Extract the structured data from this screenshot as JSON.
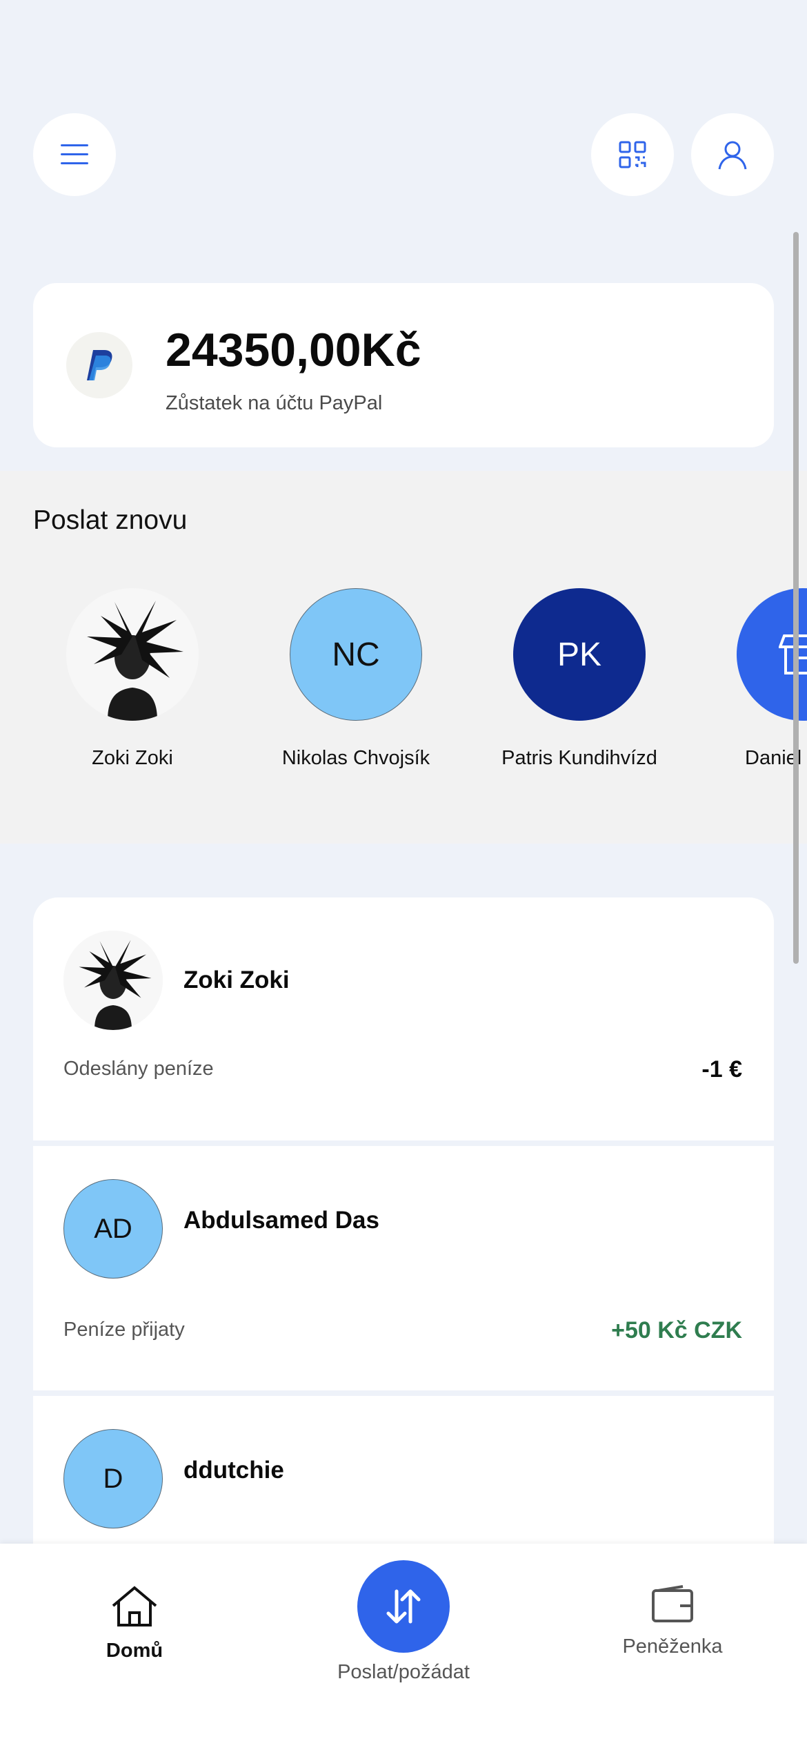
{
  "header": {
    "menu_icon": "hamburger-menu-icon",
    "qr_icon": "qr-code-icon",
    "profile_icon": "user-profile-icon"
  },
  "balance": {
    "amount": "24350,00Kč",
    "label": "Zůstatek na účtu PayPal",
    "logo_icon": "paypal-logo-icon"
  },
  "send_again": {
    "title": "Poslat znovu",
    "contacts": [
      {
        "name": "Zoki Zoki",
        "initials": "",
        "avatar": "photo"
      },
      {
        "name": "Nikolas Chvojsík",
        "initials": "NC",
        "avatar": "light"
      },
      {
        "name": "Patris Kundihvízd",
        "initials": "PK",
        "avatar": "dark"
      },
      {
        "name": "Daniel",
        "initials": "",
        "avatar": "store-icon"
      }
    ]
  },
  "transactions": [
    {
      "name": "Zoki Zoki",
      "initials": "",
      "description": "Odeslány peníze",
      "amount": "-1 €"
    },
    {
      "name": "Abdulsamed Das",
      "initials": "AD",
      "description": "Peníze přijaty",
      "amount": "+50 Kč CZK"
    },
    {
      "name": "ddutchie",
      "initials": "D",
      "description": "",
      "amount": ""
    }
  ],
  "bottom_nav": {
    "home": "Domů",
    "send_request": "Poslat/požádat",
    "wallet": "Peněženka"
  },
  "colors": {
    "accent": "#2f64ea",
    "positive": "#2f7d4f",
    "background": "#eef2f9"
  }
}
